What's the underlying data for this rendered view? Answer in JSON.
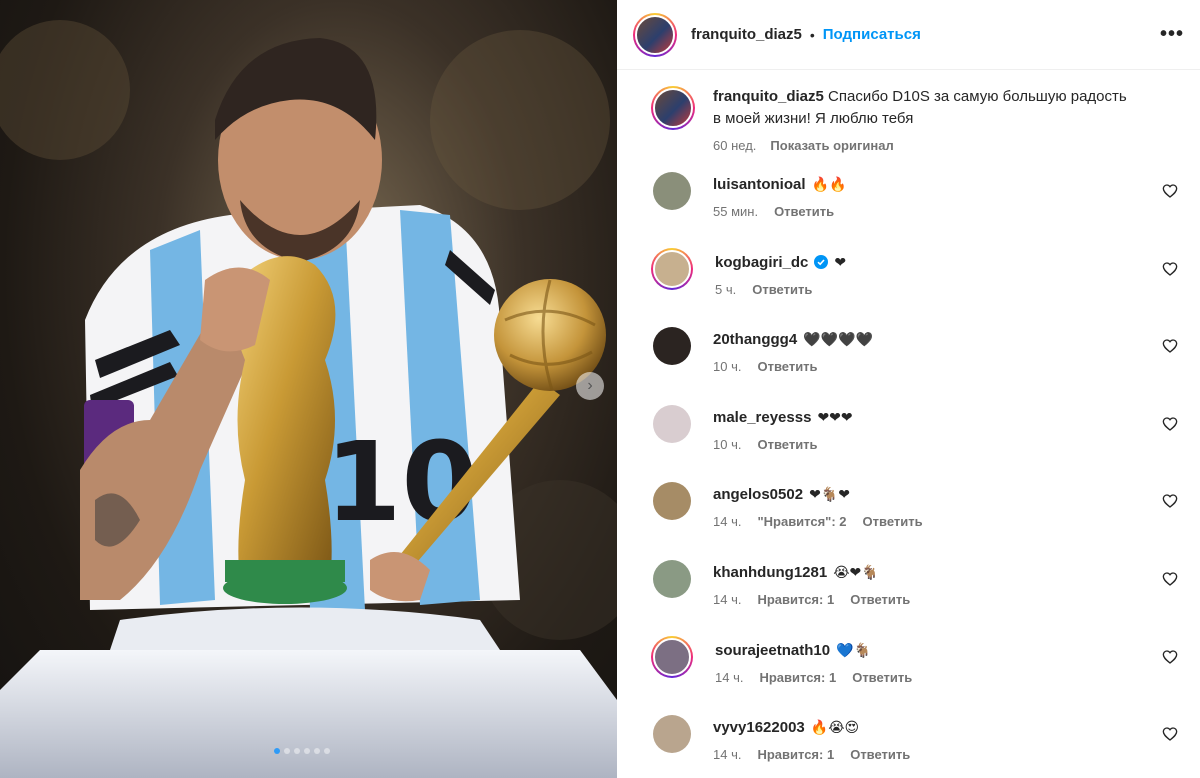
{
  "post": {
    "username": "franquito_diaz5",
    "separator": "•",
    "follow_label": "Подписаться",
    "more_label": "•••",
    "caption_text": "Спасибо D10S за самую большую радость в моей жизни! Я люблю тебя",
    "caption_time": "60 нед.",
    "show_original_label": "Показать оригинал",
    "media": {
      "next_icon": "chevron-right-icon",
      "slide_count": 6,
      "active_slide": 1
    }
  },
  "comments": [
    {
      "username": "luisantonioal",
      "text": "🔥🔥",
      "time": "55 мин.",
      "likes": "",
      "reply": "Ответить",
      "verified": false,
      "story_ring": false,
      "avatar_color": "#8a8f7a"
    },
    {
      "username": "kogbagiri_dc",
      "text": "❤",
      "time": "5 ч.",
      "likes": "",
      "reply": "Ответить",
      "verified": true,
      "story_ring": true,
      "avatar_color": "#c7b08f"
    },
    {
      "username": "20thanggg4",
      "text": "🖤🖤🖤🖤",
      "time": "10 ч.",
      "likes": "",
      "reply": "Ответить",
      "verified": false,
      "story_ring": false,
      "avatar_color": "#2b2421"
    },
    {
      "username": "male_reyesss",
      "text": "❤❤❤",
      "time": "10 ч.",
      "likes": "",
      "reply": "Ответить",
      "verified": false,
      "story_ring": false,
      "avatar_color": "#d9cdd0"
    },
    {
      "username": "angelos0502",
      "text": "❤🐐❤",
      "time": "14 ч.",
      "likes": "\"Нравится\": 2",
      "reply": "Ответить",
      "verified": false,
      "story_ring": false,
      "avatar_color": "#a68c66"
    },
    {
      "username": "khanhdung1281",
      "text": "😭❤🐐",
      "time": "14 ч.",
      "likes": "Нравится: 1",
      "reply": "Ответить",
      "verified": false,
      "story_ring": false,
      "avatar_color": "#8a9a84"
    },
    {
      "username": "sourajeetnath10",
      "text": "💙🐐",
      "time": "14 ч.",
      "likes": "Нравится: 1",
      "reply": "Ответить",
      "verified": false,
      "story_ring": true,
      "avatar_color": "#7c6f83"
    },
    {
      "username": "vyvy1622003",
      "text": "🔥😭😍",
      "time": "14 ч.",
      "likes": "Нравится: 1",
      "reply": "Ответить",
      "verified": false,
      "story_ring": false,
      "avatar_color": "#b9a58e"
    }
  ],
  "colors": {
    "accent_blue": "#0095f6",
    "verified_blue": "#0095f6",
    "text_primary": "#262626",
    "text_secondary": "#737373",
    "divider": "#efefef"
  }
}
